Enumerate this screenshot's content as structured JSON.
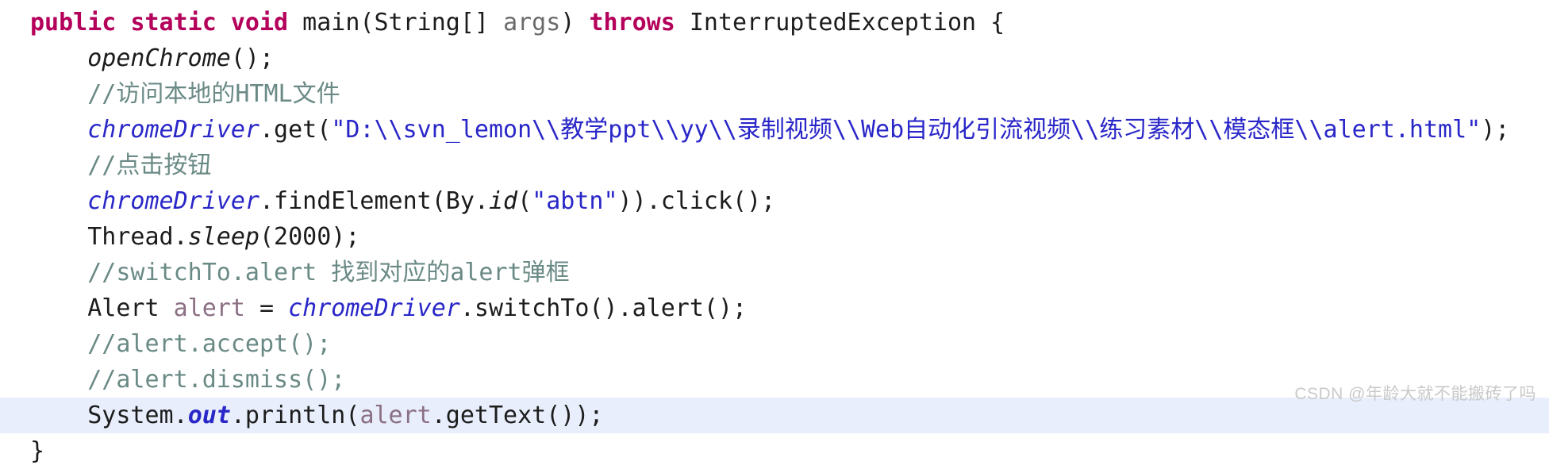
{
  "editor": {
    "language": "Java",
    "background_color": "#ffffff",
    "highlight_color": "#e8eefb",
    "colors": {
      "keyword": "#b4005a",
      "plain": "#1c1c1c",
      "parameter": "#6a6a6a",
      "comment": "#6a8a86",
      "string": "#2a27c8",
      "field": "#2a27c8",
      "variable": "#8b6f84"
    }
  },
  "code": {
    "lines": [
      {
        "index": 0,
        "indent": 0,
        "highlighted": false,
        "tokens": [
          {
            "text": "public",
            "type": "keyword"
          },
          {
            "text": " ",
            "type": "plain"
          },
          {
            "text": "static",
            "type": "keyword"
          },
          {
            "text": " ",
            "type": "plain"
          },
          {
            "text": "void",
            "type": "keyword"
          },
          {
            "text": " main(String[] ",
            "type": "plain"
          },
          {
            "text": "args",
            "type": "parameter"
          },
          {
            "text": ") ",
            "type": "plain"
          },
          {
            "text": "throws",
            "type": "keyword"
          },
          {
            "text": " InterruptedException {",
            "type": "plain"
          }
        ]
      },
      {
        "index": 1,
        "indent": 1,
        "highlighted": false,
        "tokens": [
          {
            "text": "openChrome",
            "type": "method-italic"
          },
          {
            "text": "();",
            "type": "plain"
          }
        ]
      },
      {
        "index": 2,
        "indent": 1,
        "highlighted": false,
        "tokens": [
          {
            "text": "//访问本地的HTML文件",
            "type": "comment"
          }
        ]
      },
      {
        "index": 3,
        "indent": 1,
        "highlighted": false,
        "tokens": [
          {
            "text": "chromeDriver",
            "type": "field"
          },
          {
            "text": ".get(",
            "type": "plain"
          },
          {
            "text": "\"D:\\\\svn_lemon\\\\教学ppt\\\\yy\\\\录制视频\\\\Web自动化引流视频\\\\练习素材\\\\模态框\\\\alert.html\"",
            "type": "string"
          },
          {
            "text": ");",
            "type": "plain"
          }
        ]
      },
      {
        "index": 4,
        "indent": 1,
        "highlighted": false,
        "tokens": [
          {
            "text": "//点击按钮",
            "type": "comment"
          }
        ]
      },
      {
        "index": 5,
        "indent": 1,
        "highlighted": false,
        "tokens": [
          {
            "text": "chromeDriver",
            "type": "field"
          },
          {
            "text": ".findElement(By.",
            "type": "plain"
          },
          {
            "text": "id",
            "type": "method-italic"
          },
          {
            "text": "(",
            "type": "plain"
          },
          {
            "text": "\"abtn\"",
            "type": "string"
          },
          {
            "text": ")).click();",
            "type": "plain"
          }
        ]
      },
      {
        "index": 6,
        "indent": 1,
        "highlighted": false,
        "tokens": [
          {
            "text": "Thread.",
            "type": "plain"
          },
          {
            "text": "sleep",
            "type": "method-italic"
          },
          {
            "text": "(2000);",
            "type": "plain"
          }
        ]
      },
      {
        "index": 7,
        "indent": 1,
        "highlighted": false,
        "tokens": [
          {
            "text": "//switchTo.alert 找到对应的alert弹框",
            "type": "comment"
          }
        ]
      },
      {
        "index": 8,
        "indent": 1,
        "highlighted": false,
        "tokens": [
          {
            "text": "Alert ",
            "type": "plain"
          },
          {
            "text": "alert",
            "type": "variable"
          },
          {
            "text": " = ",
            "type": "plain"
          },
          {
            "text": "chromeDriver",
            "type": "field"
          },
          {
            "text": ".switchTo().alert();",
            "type": "plain"
          }
        ]
      },
      {
        "index": 9,
        "indent": 1,
        "highlighted": false,
        "tokens": [
          {
            "text": "//alert.accept();",
            "type": "comment"
          }
        ]
      },
      {
        "index": 10,
        "indent": 1,
        "highlighted": false,
        "tokens": [
          {
            "text": "//alert.dismiss();",
            "type": "comment"
          }
        ]
      },
      {
        "index": 11,
        "indent": 1,
        "highlighted": true,
        "tokens": [
          {
            "text": "System.",
            "type": "plain"
          },
          {
            "text": "out",
            "type": "static"
          },
          {
            "text": ".println(",
            "type": "plain"
          },
          {
            "text": "alert",
            "type": "variable"
          },
          {
            "text": ".getText());",
            "type": "plain"
          }
        ]
      },
      {
        "index": 12,
        "indent": 0,
        "highlighted": false,
        "tokens": [
          {
            "text": "}",
            "type": "plain"
          }
        ]
      }
    ]
  },
  "watermark": {
    "text": "CSDN @年龄大就不能搬砖了吗"
  }
}
